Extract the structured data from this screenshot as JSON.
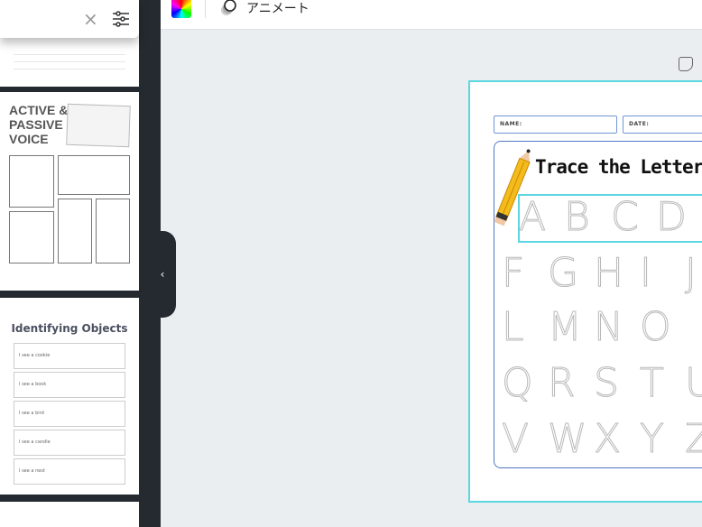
{
  "toolbar": {
    "animate_label": "アニメート",
    "color_icon": "rainbow-color-icon",
    "animate_icon": "animate-circles-icon"
  },
  "search": {
    "clear_icon": "×",
    "filter_icon": "sliders-icon"
  },
  "templates": [
    {
      "title_lines": [
        "ACTIVE &",
        "PASSIVE",
        "VOICE"
      ]
    },
    {
      "title": "Identifying Objects",
      "rows": [
        "I see a cookie",
        "I see a book",
        "I see a bird",
        "I see a candle",
        "I see a nest"
      ]
    }
  ],
  "document": {
    "name_label": "NAME:",
    "date_label": "DATE:",
    "title": "Trace the Letters",
    "rows": [
      [
        "A",
        "B",
        "C",
        "D"
      ],
      [
        "F",
        "G",
        "H",
        "I",
        "J"
      ],
      [
        "L",
        "M",
        "N",
        "O"
      ],
      [
        "Q",
        "R",
        "S",
        "T",
        "U"
      ],
      [
        "V",
        "W",
        "X",
        "Y",
        "Z"
      ]
    ]
  },
  "colors": {
    "accent": "#5cd6e0",
    "frame": "#4e79c4",
    "sidebar": "#252a31",
    "canvas": "#ebeef1"
  }
}
